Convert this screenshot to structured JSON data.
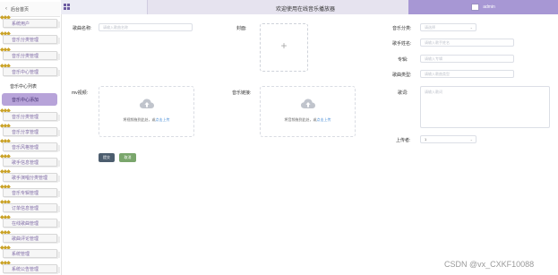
{
  "header": {
    "title": "欢迎使用在线音乐播放器",
    "user": "admin"
  },
  "sidebar": {
    "home": "后台首页",
    "items_top": [
      "系统用户",
      "音乐分类管理",
      "音乐分类管理",
      "音乐中心管理"
    ],
    "section": "音乐中心列表",
    "active": "音乐中心添加",
    "items_bottom": [
      "音乐分类管理",
      "音乐分享管理",
      "音乐风格管理",
      "歌手信息管理",
      "歌手演唱分类管理",
      "音乐专辑管理",
      "订单信息管理",
      "在线歌曲管理",
      "歌曲评论管理",
      "系统管理",
      "系统公告管理",
      "音乐推荐管理"
    ]
  },
  "form": {
    "music_name": {
      "label": "歌曲名称:",
      "placeholder": "请输入歌曲名称"
    },
    "cover": {
      "label": "封面:"
    },
    "music_category": {
      "label": "音乐分类:",
      "placeholder": "请选择"
    },
    "singer_name": {
      "label": "歌手姓名:",
      "placeholder": "请输入歌手姓名"
    },
    "album": {
      "label": "专辑:",
      "placeholder": "请输入专辑"
    },
    "music_type": {
      "label": "歌曲类型:",
      "placeholder": "请输入歌曲类型"
    },
    "mv_video": {
      "label": "mv视频:",
      "upload_hint": "将视频拖到此处，或",
      "upload_link": "点击上传"
    },
    "music_file": {
      "label": "音乐链接:",
      "upload_hint": "将音频拖到此处，或",
      "upload_link": "点击上传"
    },
    "lyrics": {
      "label": "歌词:",
      "placeholder": "请输入歌词"
    },
    "published": {
      "label": "上传者:",
      "value": "1"
    },
    "submit_label": "提交",
    "cancel_label": "取消"
  },
  "watermark": "CSDN @vx_CXKF10088"
}
